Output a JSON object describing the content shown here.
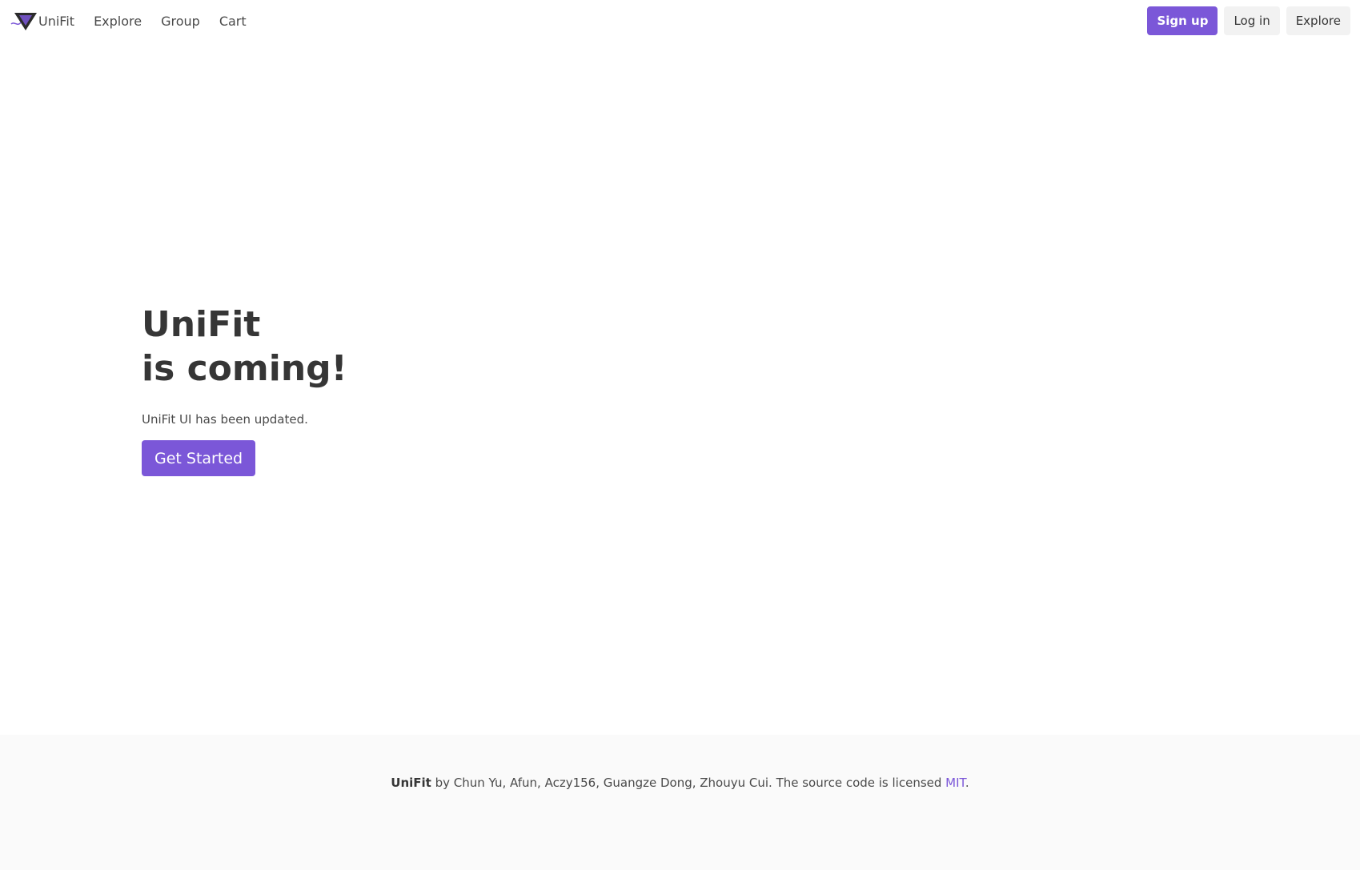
{
  "navbar": {
    "brand_name": "UniFit",
    "logo_icon": "unifit-logo-icon",
    "links": [
      "Explore",
      "Group",
      "Cart"
    ],
    "signup_label": "Sign up",
    "login_label": "Log in",
    "explore_button_label": "Explore"
  },
  "hero": {
    "title_line1": "UniFit",
    "title_line2": "is coming!",
    "subtitle": "UniFit UI has been updated.",
    "cta_label": "Get Started"
  },
  "footer": {
    "brand": "UniFit",
    "credits": " by Chun Yu, Afun, Aczy156, Guangze Dong, Zhouyu Cui. The source code is licensed ",
    "license_link": "MIT",
    "end": "."
  },
  "colors": {
    "accent": "#7b57d8",
    "light_button": "#f2f2f2",
    "footer_bg": "#fafafa",
    "text": "#363636"
  }
}
